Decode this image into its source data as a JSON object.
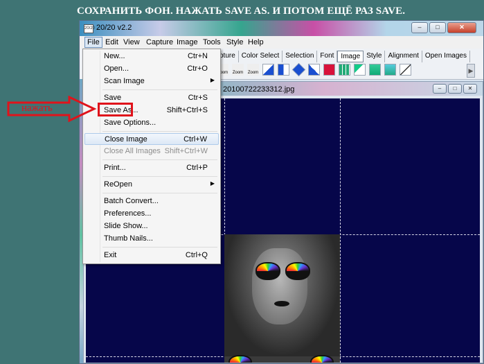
{
  "caption": "СОХРАНИТЬ ФОН. НАЖАТЬ SAVE AS. И ПОТОМ ЕЩЁ РАЗ SAVE.",
  "annotation_label": "нажать",
  "window": {
    "app_icon": "20/20",
    "title": "20/20 v2.2",
    "buttons": {
      "minimize": "–",
      "maximize": "□",
      "close": "✕"
    }
  },
  "menubar": [
    "File",
    "Edit",
    "View",
    "Capture",
    "Image",
    "Tools",
    "Style",
    "Help"
  ],
  "toolbar": {
    "tabs": [
      "pture",
      "Color Select",
      "Selection",
      "Font",
      "Image",
      "Style",
      "Alignment",
      "Open Images"
    ],
    "active_tab": "Image",
    "zoom_labels": [
      "Zoom",
      "Zoom",
      "Zoom"
    ],
    "scroll_arrow": "▶"
  },
  "document": {
    "title": "20100722233312.jpg",
    "buttons": {
      "minimize": "–",
      "maximize": "□",
      "close": "✕"
    }
  },
  "file_menu": [
    {
      "label": "New...",
      "shortcut": "Ctr+N"
    },
    {
      "label": "Open...",
      "shortcut": "Ctr+O"
    },
    {
      "label": "Scan Image",
      "submenu": "▶"
    },
    {
      "label": "Save",
      "shortcut": "Ctr+S"
    },
    {
      "label": "Save As...",
      "shortcut": "Shift+Ctrl+S"
    },
    {
      "label": "Save Options..."
    },
    {
      "label": "Close Image",
      "shortcut": "Ctrl+W"
    },
    {
      "label": "Close All Images",
      "shortcut": "Shift+Ctrl+W",
      "disabled": true
    },
    {
      "label": "Print...",
      "shortcut": "Ctrl+P"
    },
    {
      "label": "ReOpen",
      "submenu": "▶"
    },
    {
      "label": "Batch Convert..."
    },
    {
      "label": "Preferences..."
    },
    {
      "label": "Slide Show..."
    },
    {
      "label": "Thumb Nails..."
    },
    {
      "label": "Exit",
      "shortcut": "Ctrl+Q"
    }
  ],
  "colors": {
    "accent_red": "#e0131b",
    "canvas": "#06064a",
    "desktop": "#3f7474"
  }
}
